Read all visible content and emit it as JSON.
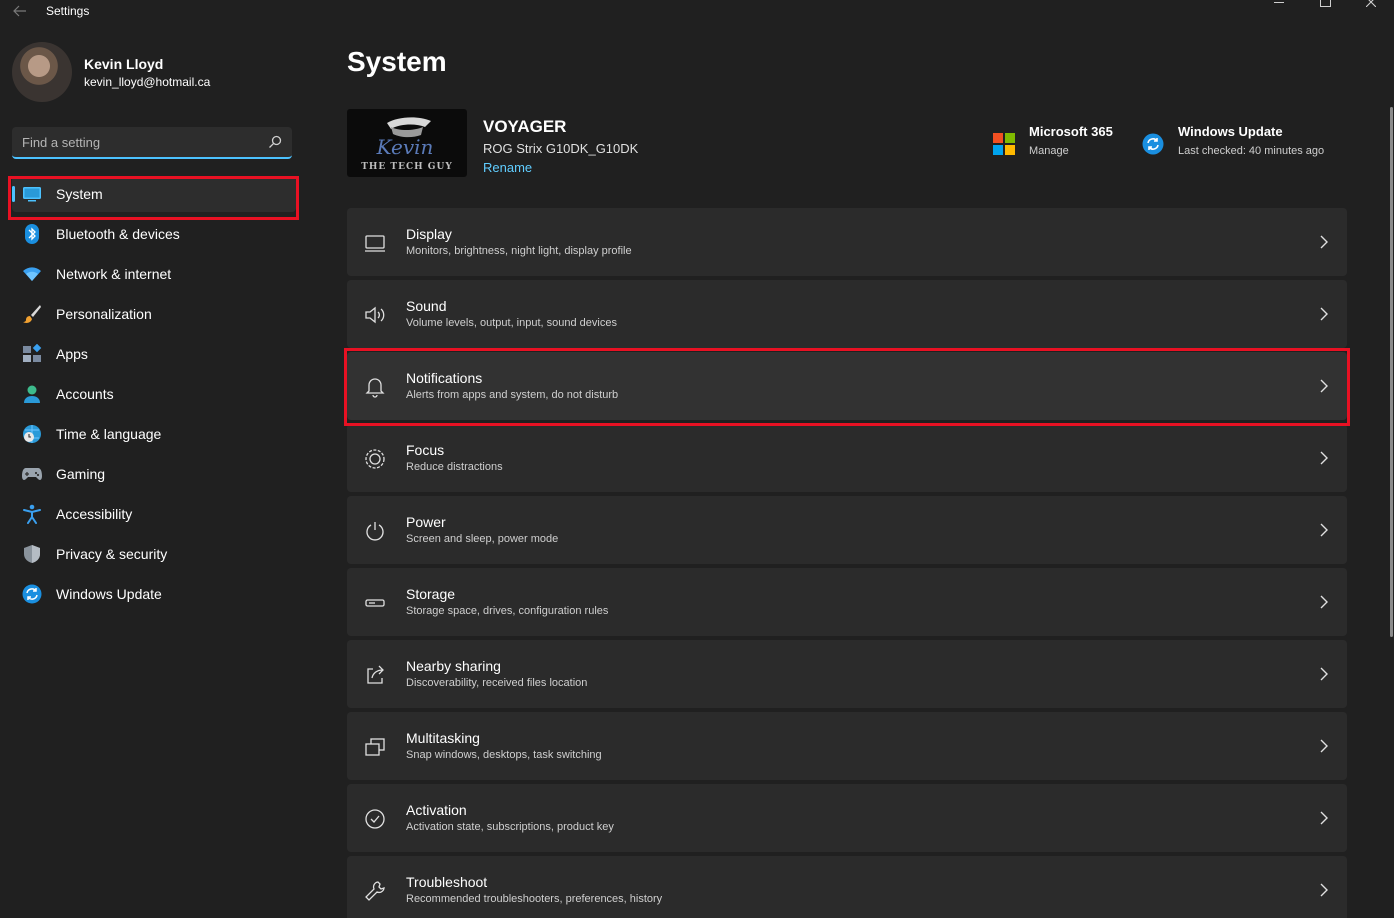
{
  "window": {
    "title": "Settings"
  },
  "profile": {
    "name": "Kevin Lloyd",
    "email": "kevin_lloyd@hotmail.ca"
  },
  "search": {
    "placeholder": "Find a setting"
  },
  "sidebar": {
    "items": [
      {
        "label": "System",
        "icon": "system-display-icon",
        "active": true
      },
      {
        "label": "Bluetooth & devices",
        "icon": "bluetooth-icon"
      },
      {
        "label": "Network & internet",
        "icon": "wifi-icon"
      },
      {
        "label": "Personalization",
        "icon": "paintbrush-icon"
      },
      {
        "label": "Apps",
        "icon": "apps-icon"
      },
      {
        "label": "Accounts",
        "icon": "person-icon"
      },
      {
        "label": "Time & language",
        "icon": "globe-clock-icon"
      },
      {
        "label": "Gaming",
        "icon": "gamepad-icon"
      },
      {
        "label": "Accessibility",
        "icon": "accessibility-icon"
      },
      {
        "label": "Privacy & security",
        "icon": "shield-icon"
      },
      {
        "label": "Windows Update",
        "icon": "update-icon"
      }
    ]
  },
  "main": {
    "title": "System",
    "device": {
      "name": "VOYAGER",
      "model": "ROG Strix G10DK_G10DK",
      "rename_label": "Rename",
      "thumb_text_1": "Kevin",
      "thumb_text_2": "THE TECH GUY"
    },
    "quick": {
      "microsoft365": {
        "title": "Microsoft 365",
        "sub": "Manage"
      },
      "windows_update": {
        "title": "Windows Update",
        "sub": "Last checked: 40 minutes ago"
      }
    },
    "cards": [
      {
        "title": "Display",
        "sub": "Monitors, brightness, night light, display profile",
        "icon": "monitor-icon"
      },
      {
        "title": "Sound",
        "sub": "Volume levels, output, input, sound devices",
        "icon": "speaker-icon"
      },
      {
        "title": "Notifications",
        "sub": "Alerts from apps and system, do not disturb",
        "icon": "bell-icon"
      },
      {
        "title": "Focus",
        "sub": "Reduce distractions",
        "icon": "focus-icon"
      },
      {
        "title": "Power",
        "sub": "Screen and sleep, power mode",
        "icon": "power-icon"
      },
      {
        "title": "Storage",
        "sub": "Storage space, drives, configuration rules",
        "icon": "storage-icon"
      },
      {
        "title": "Nearby sharing",
        "sub": "Discoverability, received files location",
        "icon": "share-icon"
      },
      {
        "title": "Multitasking",
        "sub": "Snap windows, desktops, task switching",
        "icon": "multitask-icon"
      },
      {
        "title": "Activation",
        "sub": "Activation state, subscriptions, product key",
        "icon": "checkmark-circle-icon"
      },
      {
        "title": "Troubleshoot",
        "sub": "Recommended troubleshooters, preferences, history",
        "icon": "wrench-icon"
      }
    ]
  },
  "colors": {
    "accent": "#4cc2ff",
    "highlight": "#e81123",
    "background": "#202020",
    "card": "#2b2b2b"
  }
}
